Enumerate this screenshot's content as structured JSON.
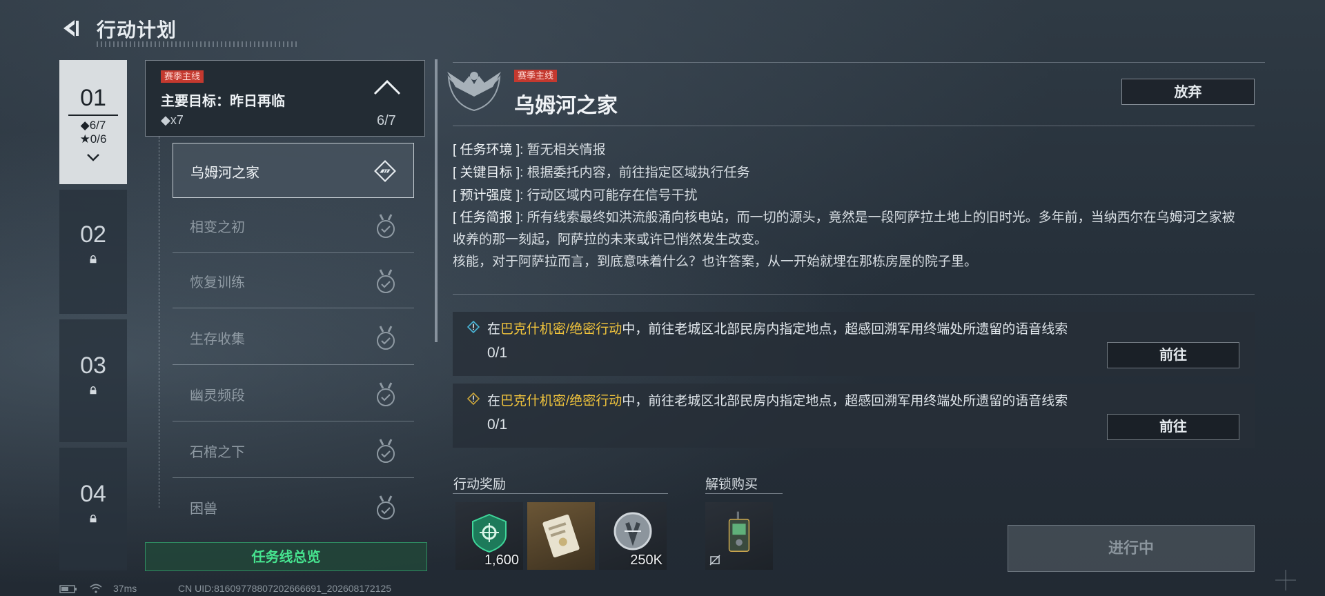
{
  "header": {
    "title": "行动计划"
  },
  "chapters": [
    {
      "num": "01",
      "progress_a": "◆6/7",
      "progress_b": "★0/6"
    },
    {
      "num": "02"
    },
    {
      "num": "03"
    },
    {
      "num": "04"
    }
  ],
  "quest_list": {
    "tag": "赛季主线",
    "main_goal": "主要目标：昨日再临",
    "reward_count": "◆x7",
    "progress": "6/7",
    "items": [
      {
        "label": "乌姆河之家"
      },
      {
        "label": "相变之初"
      },
      {
        "label": "恢复训练"
      },
      {
        "label": "生存收集"
      },
      {
        "label": "幽灵频段"
      },
      {
        "label": "石棺之下"
      },
      {
        "label": "困兽"
      }
    ],
    "overview_button": "任务线总览"
  },
  "detail": {
    "tag": "赛季主线",
    "title": "乌姆河之家",
    "abandon_button": "放弃",
    "env_key": "[ 任务环境 ]",
    "env_val": ": 暂无相关情报",
    "goal_key": "[ 关键目标 ]",
    "goal_val": ": 根据委托内容，前往指定区域执行任务",
    "intensity_key": "[ 预计强度 ]",
    "intensity_val": ": 行动区域内可能存在信号干扰",
    "brief_key": "[ 任务简报 ]",
    "brief_val": ": 所有线索最终如洪流般涌向核电站，而一切的源头，竟然是一段阿萨拉土地上的旧时光。多年前，当纳西尔在乌姆河之家被收养的那一刻起，阿萨拉的未来或许已悄然发生改变。",
    "brief_val2": "核能，对于阿萨拉而言，到底意味着什么？也许答案，从一开始就埋在那栋房屋的院子里。"
  },
  "tasks": [
    {
      "pre": "在",
      "hl": "巴克什机密/绝密行动",
      "post": "中，前往老城区北部民房内指定地点，超感回溯军用终端处所遗留的语音线索",
      "progress": "0/1",
      "button": "前往"
    },
    {
      "pre": "在",
      "hl": "巴克什机密/绝密行动",
      "post": "中，前往老城区北部民房内指定地点，超感回溯军用终端处所遗留的语音线索",
      "progress": "0/1",
      "button": "前往"
    }
  ],
  "rewards": {
    "label": "行动奖励",
    "items": [
      {
        "icon": "green-crest-icon",
        "amount": "1,600"
      },
      {
        "icon": "document-card-icon",
        "amount": ""
      },
      {
        "icon": "silver-coin-icon",
        "amount": "250K"
      }
    ]
  },
  "unlock": {
    "label": "解锁购买",
    "items": [
      {
        "icon": "radio-device-icon"
      }
    ]
  },
  "status_button": "进行中",
  "status_bar": {
    "ping": "37ms",
    "uid": "CN UID:81609778807202666691_202608172125"
  },
  "colors": {
    "highlight": "#f1c43c",
    "tag_red": "#c4392f",
    "overview_green": "#46e38f"
  }
}
